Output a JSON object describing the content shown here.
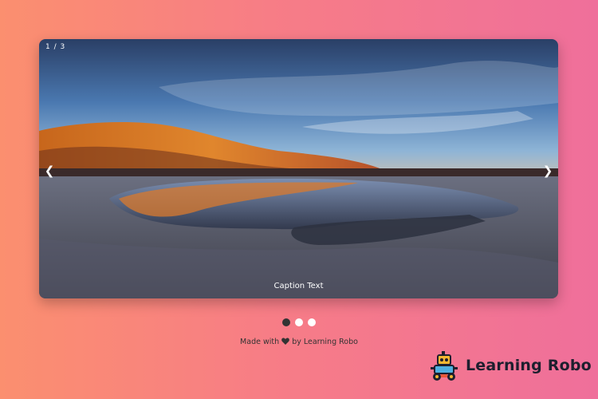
{
  "slideshow": {
    "counter": "1 / 3",
    "prev_glyph": "❮",
    "next_glyph": "❯",
    "caption": "Caption Text",
    "image_alt": "desert-salt-flat-lake-sunset",
    "slide_count": 3,
    "active_slide": 1
  },
  "footer": {
    "made_with": "Made with",
    "heart_icon": "heart-icon",
    "by_text": "by Learning Robo"
  },
  "brand": {
    "name": "Learning Robo",
    "logo_icon": "robot-icon"
  },
  "colors": {
    "bg_start": "#fb8f6f",
    "bg_end": "#ef6f9b",
    "dot_active": "#333333",
    "dot_inactive": "#ffffff"
  }
}
